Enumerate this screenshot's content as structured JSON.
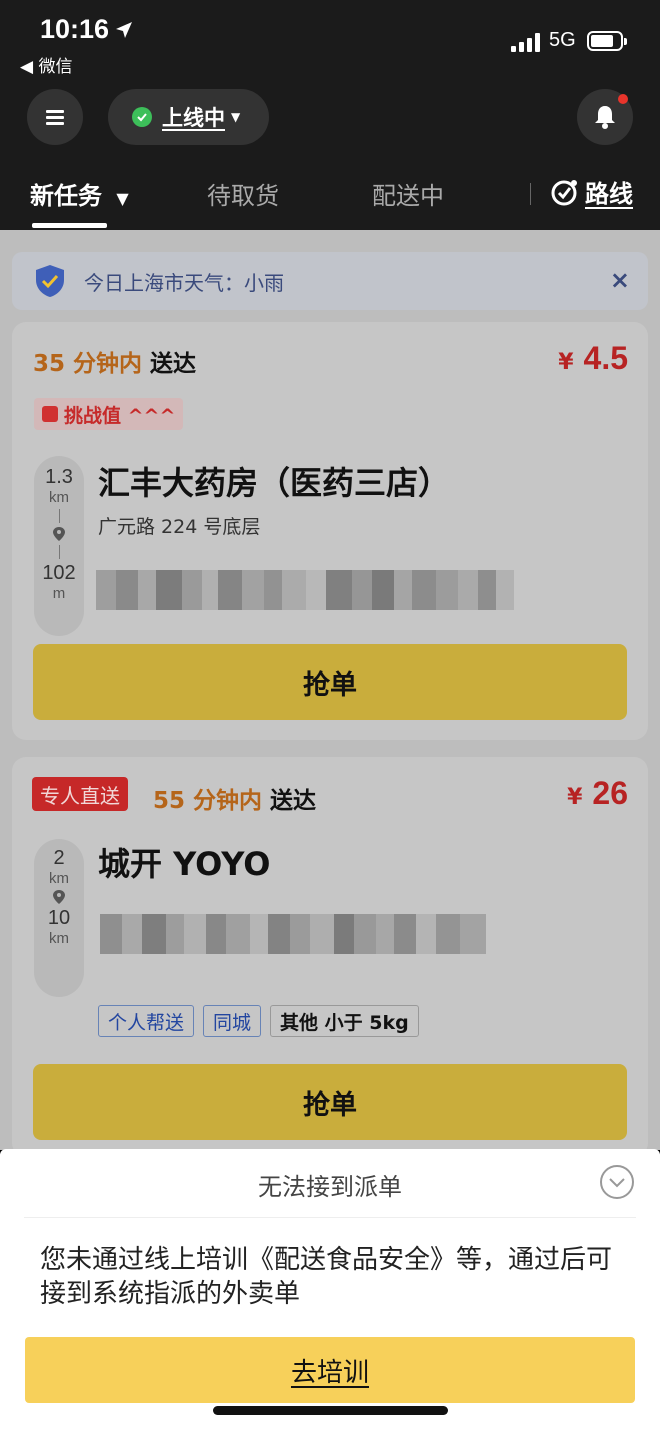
{
  "status_bar": {
    "time": "10:16",
    "back_app": "◀ 微信",
    "network": "5G"
  },
  "header": {
    "online_label": "上线中",
    "menu_icon": "menu-icon",
    "bell_icon": "bell-icon"
  },
  "tabs": [
    {
      "label": "新任务",
      "active": true
    },
    {
      "label": "待取货",
      "active": false
    },
    {
      "label": "配送中",
      "active": false
    }
  ],
  "route_label": "路线",
  "notice": {
    "text": "今日上海市天气：小雨",
    "close": "×"
  },
  "orders": [
    {
      "eta": "35 分钟内",
      "eta_suffix": "送达",
      "currency": "¥",
      "price": "4.5",
      "challenge_label": "挑战值 ^^^",
      "dist_pickup": "1.3",
      "dist_pickup_unit": "km",
      "dist_drop": "102",
      "dist_drop_unit": "m",
      "store": "汇丰大药房（医药三店）",
      "address": "广元路 224 号底层",
      "grab_label": "抢单"
    },
    {
      "badge": "专人直送",
      "eta": "55 分钟内",
      "eta_suffix": "送达",
      "currency": "¥",
      "price": "26",
      "dist_pickup": "2",
      "dist_pickup_unit": "km",
      "dist_drop": "10",
      "dist_drop_unit": "km",
      "store": "城开 YOYO",
      "tags": [
        "个人帮送",
        "同城",
        "其他 小于 5kg"
      ],
      "grab_label": "抢单"
    }
  ],
  "sheet": {
    "title": "无法接到派单",
    "message": "您未通过线上培训《配送食品安全》等，通过后可接到系统指派的外卖单",
    "cta": "去培训"
  },
  "colors": {
    "accent": "#f7d05a",
    "price": "#b72323",
    "eta": "#b5651a"
  }
}
